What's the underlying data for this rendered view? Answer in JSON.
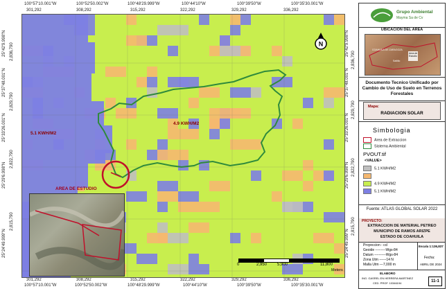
{
  "coords": {
    "top": [
      "301,292",
      "100°57'10.001\"W",
      "308,292",
      "100°52'50.002\"W",
      "315,292",
      "100°48'29.999\"W",
      "322,292",
      "100°44'10\"W",
      "329,292",
      "100°39'50\"W",
      "336,292",
      "100°35'30.001\"W"
    ],
    "bottom": [
      "301,292",
      "100°57'10.001\"W",
      "308,292",
      "100°52'50.002\"W",
      "315,292",
      "100°48'29.999\"W",
      "322,292",
      "100°44'10\"W",
      "329,292",
      "100°39'50\"W",
      "336,292",
      "100°35'30.001\"W"
    ],
    "left": [
      "25°42'9.998\"N",
      "2,836,790",
      "25°37'48.001\"N",
      "2,829,790",
      "25°33'26.001\"N",
      "25°29'6.998\"N",
      "2,822,790",
      "25°24'49.999\"N",
      "2,815,790"
    ],
    "right": [
      "25°42'9.998\"N",
      "2,836,790",
      "25°37'48.001\"N",
      "2,829,790",
      "25°33'26.001\"N",
      "25°29'6.998\"N",
      "2,822,790",
      "25°24'49.999\"N",
      "2,815,790"
    ]
  },
  "map": {
    "label_left": "5.1 KWH/M2",
    "label_center": "4.9 KWH/M2",
    "study_area_label": "AREA DE ESTUDIO",
    "north_letter": "N",
    "scale_ticks": [
      "0",
      "2,950",
      "5,900",
      "11,800"
    ],
    "scale_unit": "Meters"
  },
  "panel": {
    "logo_title": "Grupo Ambiental",
    "logo_subtitle": "Mayma Sa de Cv",
    "location_title": "UBICACION DEL AREA",
    "locator_labels": [
      "Area de Estudio",
      "Saltillo",
      "COAHUILA DE ZARAGOZA"
    ],
    "doc_title": "Documento Tecnico Unificado por Cambio de Uso de Suelo en Terrenos Forestales",
    "map_label": "Mapa:",
    "map_name": "RADIACION SOLAR",
    "symbology_title": "Simbologia",
    "symbols": [
      "Area de Extraccion",
      "Sistema Ambiental"
    ],
    "pvout": "PVOUT.tif",
    "value_label": "<VALUE>",
    "classes": [
      {
        "label": "5.1 KWH/M2",
        "color": "#bfbfbf"
      },
      {
        "label": "",
        "color": "#f5b870"
      },
      {
        "label": "4.9 KWH/M2",
        "color": "#c8ee4e"
      },
      {
        "label": "5.1 KWH/M2",
        "color": "#7d7fe3"
      }
    ],
    "source": "Fuente: ATLAS GLOBAL SOLAR 2022",
    "project_label": "PROYECTO:",
    "project_lines": [
      "EXTRACCION DE MATERIAL PETREO",
      "MUNICIPIO DE RAMOS ARIZPE",
      "ESTADO DE COAHUILA"
    ],
    "projection_lines": [
      "Proyeccion - ccl",
      "Geoide ---------Wgs-84",
      "Datum ----------Wgs-84",
      "Zona Utm ------14 N",
      "Malla Utm ---7,000 m"
    ],
    "scale_text": "Escala 1:136,837",
    "date_label": "Fecha:",
    "date_value": "ABRIL DE 2024",
    "elaboro_label": "ELABORO",
    "elaboro_lines": [
      "ING. GASREL EN HERRERA MARTINEZ",
      "CED. PROF. 10346194"
    ],
    "sheet": "11-1"
  },
  "colors": {
    "green": "#c8ee4e",
    "purple": "#7d7fe3",
    "orange": "#f5b870",
    "boundary": "#2f8a3c",
    "study": "#c0102a"
  }
}
